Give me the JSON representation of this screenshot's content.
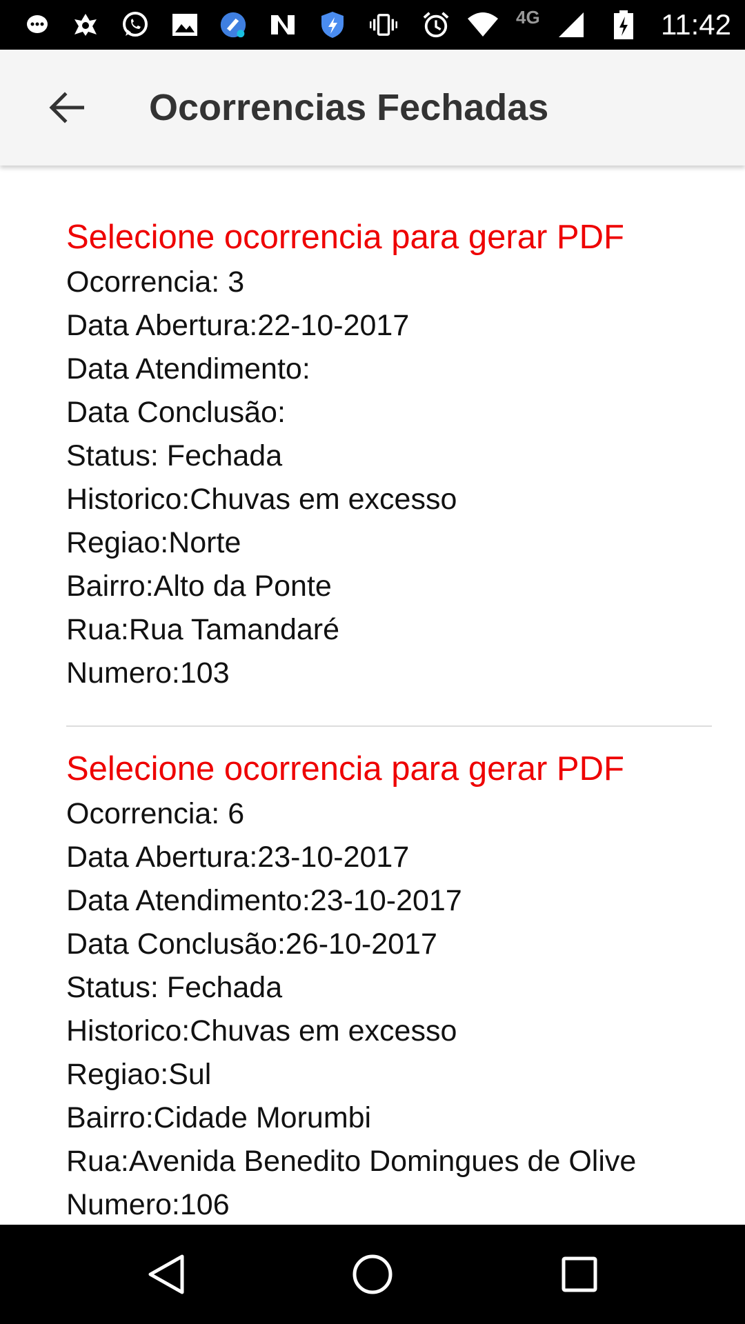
{
  "status_bar": {
    "time": "11:42",
    "network_label": "4G",
    "icons": [
      "messaging-icon",
      "app-icon",
      "whatsapp-icon",
      "image-icon",
      "cleaner-icon",
      "n-app-icon",
      "shield-icon",
      "vibrate-icon",
      "alarm-icon",
      "wifi-icon",
      "signal-icon",
      "battery-charging-icon"
    ]
  },
  "app_bar": {
    "back_icon": "arrow-back-icon",
    "title": "Ocorrencias Fechadas"
  },
  "records": [
    {
      "heading": "Selecione ocorrencia para gerar PDF",
      "ocorrencia": "Ocorrencia: 3",
      "data_abertura": "Data Abertura:22-10-2017",
      "data_atendimento": "Data Atendimento:",
      "data_conclusao": "Data Conclusão:",
      "status": "Status: Fechada",
      "historico": "Historico:Chuvas em excesso",
      "regiao": "Regiao:Norte",
      "bairro": "Bairro:Alto da Ponte",
      "rua": "Rua:Rua Tamandaré",
      "numero": "Numero:103"
    },
    {
      "heading": "Selecione ocorrencia para gerar PDF",
      "ocorrencia": "Ocorrencia: 6",
      "data_abertura": "Data Abertura:23-10-2017",
      "data_atendimento": "Data Atendimento:23-10-2017",
      "data_conclusao": "Data Conclusão:26-10-2017",
      "status": "Status: Fechada",
      "historico": "Historico:Chuvas em excesso",
      "regiao": "Regiao:Sul",
      "bairro": "Bairro:Cidade Morumbi",
      "rua": "Rua:Avenida Benedito Domingues de Olive",
      "numero": "Numero:106"
    }
  ],
  "colors": {
    "heading": "#ee0000",
    "app_bar_bg": "#f5f5f5",
    "system_bars": "#000000"
  },
  "nav_bar": {
    "icons": [
      "back-triangle-icon",
      "home-circle-icon",
      "recents-square-icon"
    ]
  }
}
